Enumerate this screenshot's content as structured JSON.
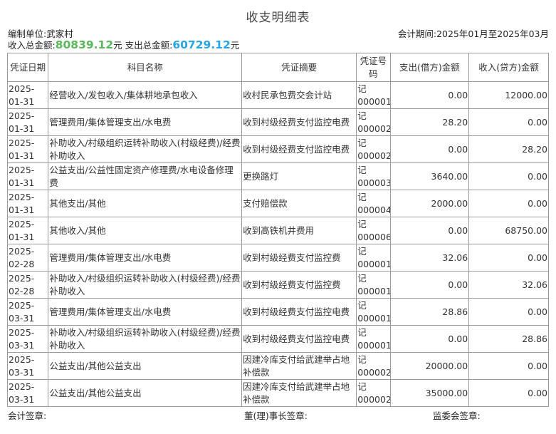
{
  "title": "收支明细表",
  "header": {
    "unit_label": "编制单位:",
    "unit_name": "武家村",
    "period_label": "会计期间:",
    "period_value": "2025年01月至2025年03月",
    "income_label": "收入总金额:",
    "income_amount": "80839.12",
    "income_suffix": "元",
    "expense_label": "支出总金额:",
    "expense_amount": "60729.12",
    "expense_suffix": "元",
    "income_color": "#5cb85c",
    "expense_color": "#2aa4e8"
  },
  "table": {
    "columns": [
      "凭证日期",
      "科目名称",
      "凭证摘要",
      "凭证号码",
      "支出(借方)金额",
      "收入(贷方)金额"
    ],
    "rows": [
      {
        "date": "2025-01-31",
        "subject": "经营收入/发包收入/集体耕地承包收入",
        "summary": "收村民承包费交会计站",
        "voucher": "记000001",
        "debit": "0.00",
        "credit": "12000.00"
      },
      {
        "date": "2025-01-31",
        "subject": "管理费用/集体管理支出/水电费",
        "summary": "收到村级经费支付监控电费",
        "voucher": "记000002",
        "debit": "28.20",
        "credit": "0.00"
      },
      {
        "date": "2025-01-31",
        "subject": "补助收入/村级组织运转补助收入(村级经费)/经费补助收入",
        "summary": "收到村级经费支付监控电费",
        "voucher": "记000002",
        "debit": "0.00",
        "credit": "28.20"
      },
      {
        "date": "2025-01-31",
        "subject": "公益支出/公益性固定资产修理费/水电设备修理费",
        "summary": "更换路灯",
        "voucher": "记000003",
        "debit": "3640.00",
        "credit": "0.00"
      },
      {
        "date": "2025-01-31",
        "subject": "其他支出/其他",
        "summary": "支付赔偿款",
        "voucher": "记000004",
        "debit": "2000.00",
        "credit": "0.00"
      },
      {
        "date": "2025-01-31",
        "subject": "其他收入/其他",
        "summary": "收到高铁机井费用",
        "voucher": "记000006",
        "debit": "0.00",
        "credit": "68750.00"
      },
      {
        "date": "2025-02-28",
        "subject": "管理费用/集体管理支出/水电费",
        "summary": "收到村级经费支付监控费",
        "voucher": "记000001",
        "debit": "32.06",
        "credit": "0.00"
      },
      {
        "date": "2025-02-28",
        "subject": "补助收入/村级组织运转补助收入(村级经费)/经费补助收入",
        "summary": "收到村级经费支付监控费",
        "voucher": "记000001",
        "debit": "0.00",
        "credit": "32.06"
      },
      {
        "date": "2025-03-31",
        "subject": "管理费用/集体管理支出/水电费",
        "summary": "收到村级经费支付监控电费",
        "voucher": "记000001",
        "debit": "28.86",
        "credit": "0.00"
      },
      {
        "date": "2025-03-31",
        "subject": "补助收入/村级组织运转补助收入(村级经费)/经费补助收入",
        "summary": "收到村级经费支付监控电费",
        "voucher": "记000001",
        "debit": "0.00",
        "credit": "28.86"
      },
      {
        "date": "2025-03-31",
        "subject": "公益支出/其他公益支出",
        "summary": "因建冷库支付给武建举占地补偿款",
        "voucher": "记000002",
        "debit": "20000.00",
        "credit": "0.00"
      },
      {
        "date": "2025-03-31",
        "subject": "公益支出/其他公益支出",
        "summary": "因建冷库支付给武建举占地补偿款",
        "voucher": "记000002",
        "debit": "35000.00",
        "credit": "0.00"
      }
    ]
  },
  "footer": {
    "accountant": "会计签章:",
    "chairman": "董(理)事长签章:",
    "supervisor": "监委会签章:"
  }
}
